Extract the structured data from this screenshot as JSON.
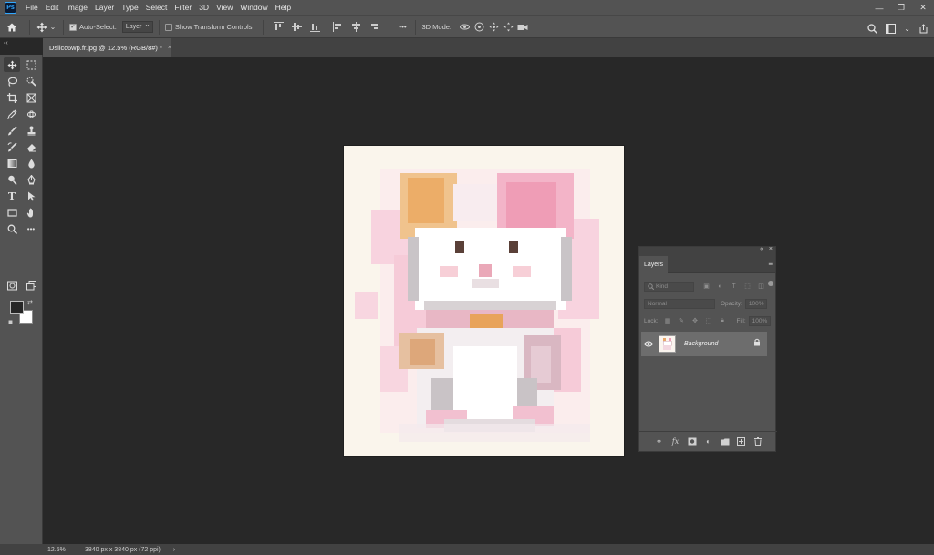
{
  "app": {
    "logo": "Ps"
  },
  "menu": [
    "File",
    "Edit",
    "Image",
    "Layer",
    "Type",
    "Select",
    "Filter",
    "3D",
    "View",
    "Window",
    "Help"
  ],
  "window_controls": {
    "minimize": "—",
    "restore": "❐",
    "close": "✕"
  },
  "options_bar": {
    "auto_select_label": "Auto-Select:",
    "auto_select_target": "Layer",
    "transform_label": "Show Transform Controls",
    "more": "•••",
    "mode_3d_label": "3D Mode:"
  },
  "document": {
    "tab_title": "Dsiicc6wp.fr.jpg @ 12.5% (RGB/8#) *",
    "tab_close": "×",
    "collapse": "‹‹"
  },
  "toolbar": {
    "more_tools": "•••",
    "foreground_color": "#262626",
    "background_color": "#ffffff"
  },
  "layers_panel": {
    "tab": "Layers",
    "kind_label": "Kind",
    "blend_mode": "Normal",
    "opacity_label": "Opacity:",
    "opacity_value": "100%",
    "lock_label": "Lock:",
    "fill_label": "Fill:",
    "fill_value": "100%",
    "layer": {
      "name": "Background",
      "visible": true,
      "locked": true
    },
    "collapse": "«",
    "close": "×",
    "menu": "≡"
  },
  "status": {
    "zoom": "12.5%",
    "doc_size": "3840 px x 3840 px (72 ppi)",
    "arrow": "›"
  },
  "colors": {
    "ui_panel": "#535353",
    "ui_dark": "#424242",
    "workspace": "#282828",
    "brand": "#31a8ff"
  }
}
